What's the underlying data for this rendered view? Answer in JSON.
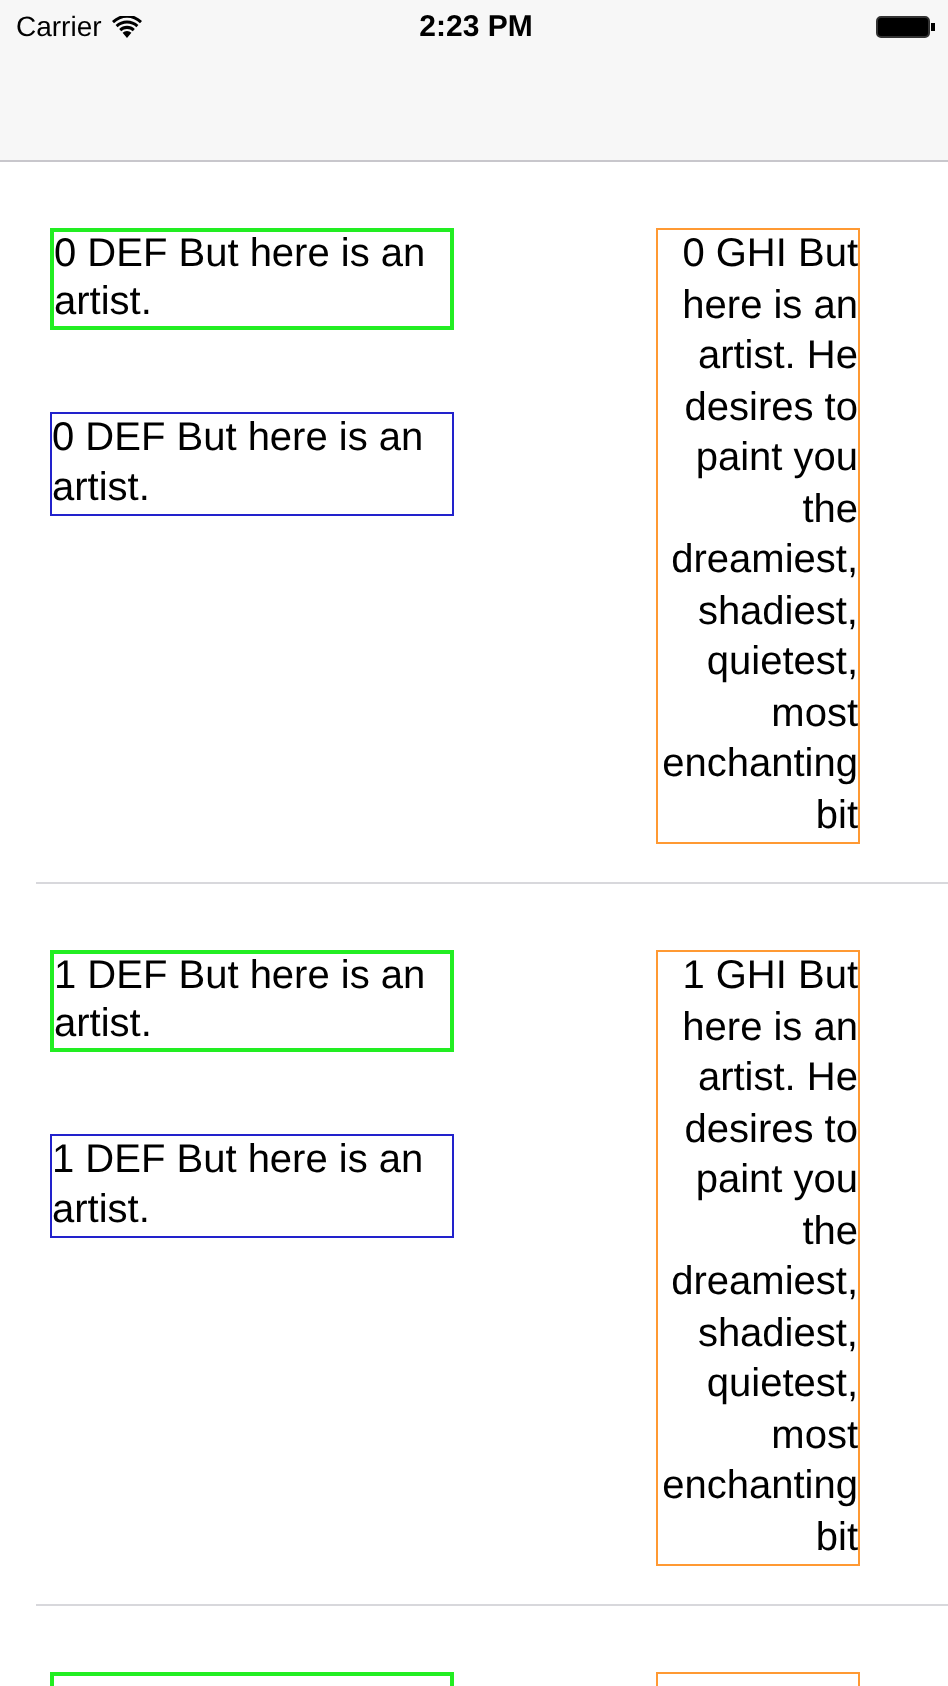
{
  "status_bar": {
    "carrier": "Carrier",
    "time": "2:23 PM"
  },
  "rows": [
    {
      "labels": [
        {
          "kind": "top",
          "color": "#22ee22",
          "text": "0 DEF But here is an artist."
        },
        {
          "kind": "bottom",
          "color": "#2222cc",
          "text": "0 DEF But here is an artist."
        },
        {
          "kind": "side",
          "color": "#ff9933",
          "text": "0 GHI But here is an artist. He desires to paint you the dreamiest, shadiest, quietest, most enchanting bit"
        }
      ]
    },
    {
      "labels": [
        {
          "kind": "top",
          "color": "#22ee22",
          "text": "1 DEF But here is an artist."
        },
        {
          "kind": "bottom",
          "color": "#2222cc",
          "text": "1 DEF But here is an artist."
        },
        {
          "kind": "side",
          "color": "#ff9933",
          "text": "1 GHI But here is an artist. He desires to paint you the dreamiest, shadiest, quietest, most enchanting bit"
        }
      ]
    },
    {
      "labels": [
        {
          "kind": "top",
          "color": "#22ee22"
        },
        {
          "kind": "side",
          "color": "#ff9933"
        }
      ]
    }
  ]
}
